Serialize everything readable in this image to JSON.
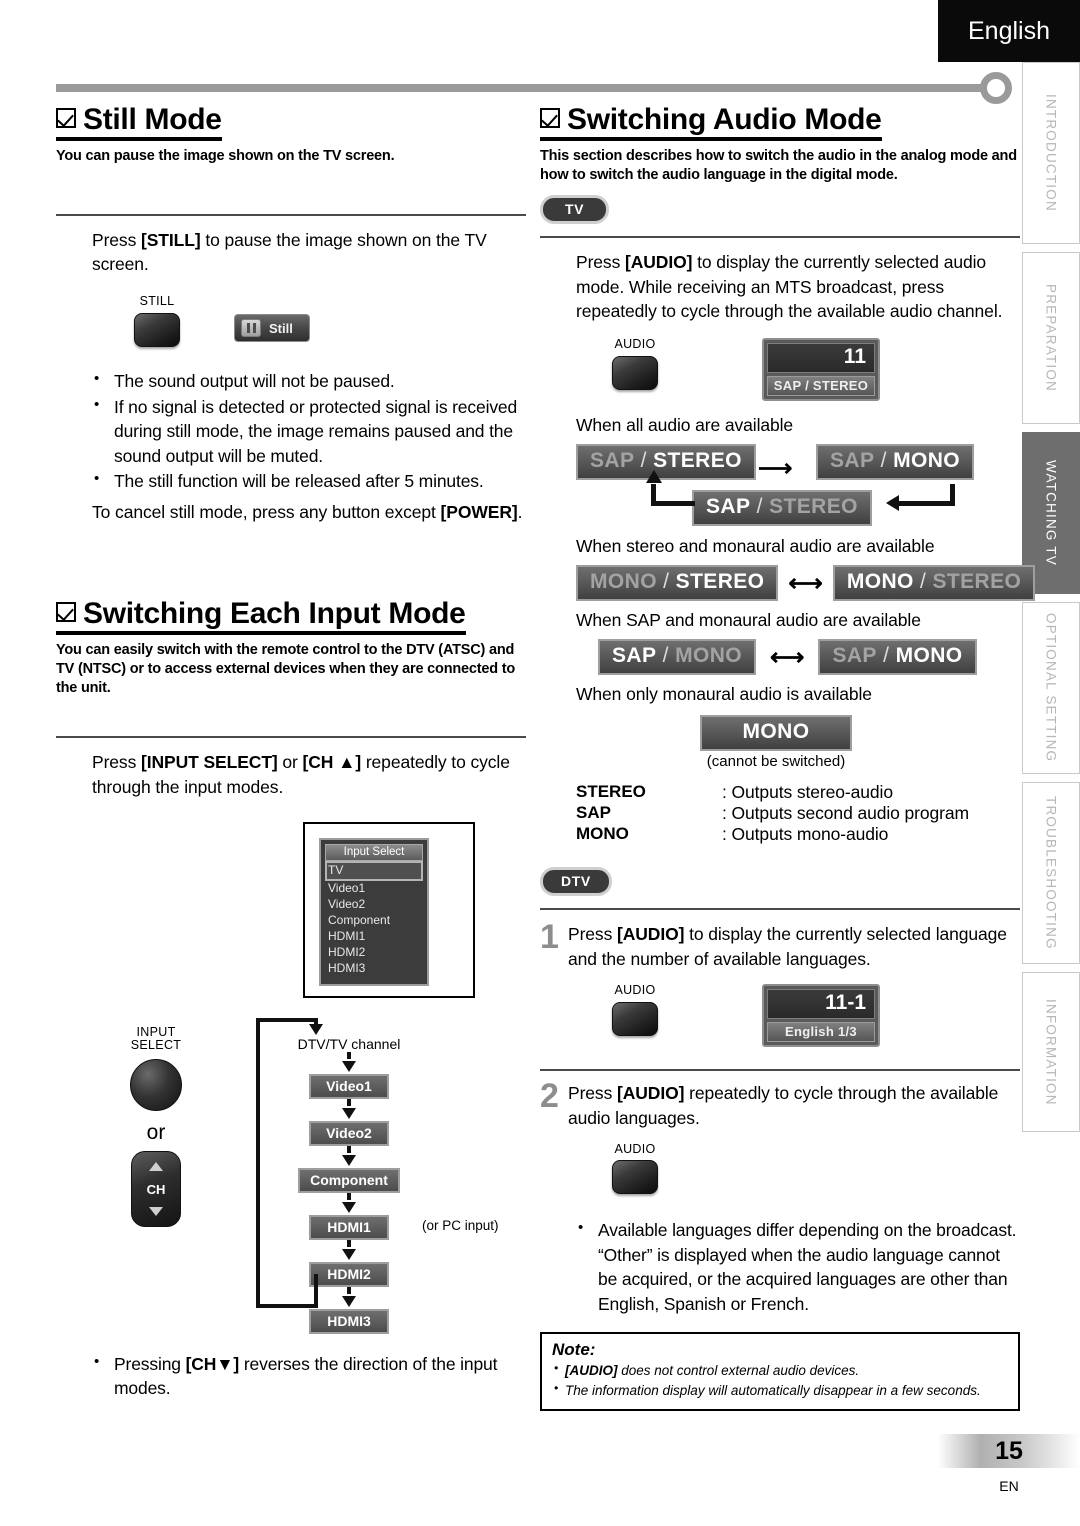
{
  "header": {
    "language_tab": "English"
  },
  "side_tabs": [
    {
      "label": "INTRODUCTION",
      "active": false
    },
    {
      "label": "PREPARATION",
      "active": false
    },
    {
      "label": "WATCHING TV",
      "active": true
    },
    {
      "label": "OPTIONAL SETTING",
      "active": false
    },
    {
      "label": "TROUBLESHOOTING",
      "active": false
    },
    {
      "label": "INFORMATION",
      "active": false
    }
  ],
  "still_mode": {
    "title": "Still Mode",
    "description": "You can pause the image shown on the TV screen.",
    "instruction_pre": "Press ",
    "instruction_key": "[STILL]",
    "instruction_post": " to pause the image shown on the TV screen.",
    "button_label": "STILL",
    "osd_still_label": "Still",
    "bullets": [
      "The sound output will not be paused.",
      "If no signal is detected or protected signal is received during still mode, the image remains paused and the sound output will be muted.",
      "The still function will be released after 5 minutes."
    ],
    "cancel_pre": "To cancel still mode, press any button except ",
    "cancel_key": "[POWER]",
    "cancel_post": "."
  },
  "input_mode": {
    "title": "Switching Each Input Mode",
    "description": "You can easily switch with the remote control to the DTV (ATSC) and TV (NTSC) or to access external devices when they are connected to the unit.",
    "instruction_pre": "Press ",
    "instruction_key1": "[INPUT SELECT]",
    "instruction_mid": " or ",
    "instruction_key2": "[CH ▲]",
    "instruction_post": " repeatedly to cycle through the input modes.",
    "osd_menu_title": "Input Select",
    "osd_menu_items": [
      "TV",
      "Video1",
      "Video2",
      "Component",
      "HDMI1",
      "HDMI2",
      "HDMI3"
    ],
    "osd_menu_selected": "TV",
    "button_label_line1": "INPUT",
    "button_label_line2": "SELECT",
    "or_label": "or",
    "ch_button_label": "CH",
    "flow_head": "DTV/TV channel",
    "flow_items": [
      "Video1",
      "Video2",
      "Component",
      "HDMI1",
      "HDMI2",
      "HDMI3"
    ],
    "flow_note": "(or PC input)",
    "bullet_pre": "Pressing ",
    "bullet_key": "[CH▼]",
    "bullet_post": " reverses the direction of the input modes."
  },
  "audio_mode": {
    "title": "Switching Audio Mode",
    "description": "This section describes how to switch the audio in the analog mode and how to switch the audio language in the digital mode.",
    "badge_tv": "TV",
    "badge_dtv": "DTV",
    "tv_instruction_pre": "Press ",
    "tv_instruction_key": "[AUDIO]",
    "tv_instruction_post": " to display the currently selected audio mode. While receiving an MTS broadcast, press repeatedly to cycle through the available audio channel.",
    "audio_button_label": "AUDIO",
    "osd_channel": "11",
    "osd_mode": "SAP / STEREO",
    "case1_caption": "When all audio are available",
    "case1_chips": [
      {
        "left": "SAP",
        "left_on": false,
        "right": "STEREO",
        "right_on": true
      },
      {
        "left": "SAP",
        "left_on": false,
        "right": "MONO",
        "right_on": true
      },
      {
        "left": "SAP",
        "left_on": true,
        "right": "STEREO",
        "right_on": false
      }
    ],
    "case2_caption": "When stereo and monaural audio are available",
    "case2_chips": [
      {
        "left": "MONO",
        "left_on": false,
        "right": "STEREO",
        "right_on": true
      },
      {
        "left": "MONO",
        "left_on": true,
        "right": "STEREO",
        "right_on": false
      }
    ],
    "case3_caption": "When SAP and monaural audio are available",
    "case3_chips": [
      {
        "left": "SAP",
        "left_on": true,
        "right": "MONO",
        "right_on": false
      },
      {
        "left": "SAP",
        "left_on": false,
        "right": "MONO",
        "right_on": true
      }
    ],
    "case4_caption": "When only monaural audio is available",
    "case4_chip": "MONO",
    "case4_note": "(cannot be switched)",
    "legend": [
      {
        "term": "STEREO",
        "def": ": Outputs stereo-audio"
      },
      {
        "term": "SAP",
        "def": ": Outputs second audio program"
      },
      {
        "term": "MONO",
        "def": ": Outputs mono-audio"
      }
    ],
    "step1_num": "1",
    "step1_pre": "Press ",
    "step1_key": "[AUDIO]",
    "step1_post": " to display the currently selected language and the number of available languages.",
    "osd_channel_dtv": "11-1",
    "osd_lang_dtv": "English 1/3",
    "step2_num": "2",
    "step2_pre": "Press ",
    "step2_key": "[AUDIO]",
    "step2_post": " repeatedly to cycle through the available audio languages.",
    "bullet": "Available languages differ depending on the broadcast. “Other” is displayed when the audio language cannot be acquired, or the acquired languages are other than English, Spanish or French.",
    "note_title": "Note:",
    "notes": [
      {
        "key": "[AUDIO]",
        "rest": " does not control external audio devices."
      },
      {
        "key": "",
        "rest": "The information display will automatically disappear in a few seconds."
      }
    ]
  },
  "footer": {
    "page_number": "15",
    "page_code": "EN"
  }
}
